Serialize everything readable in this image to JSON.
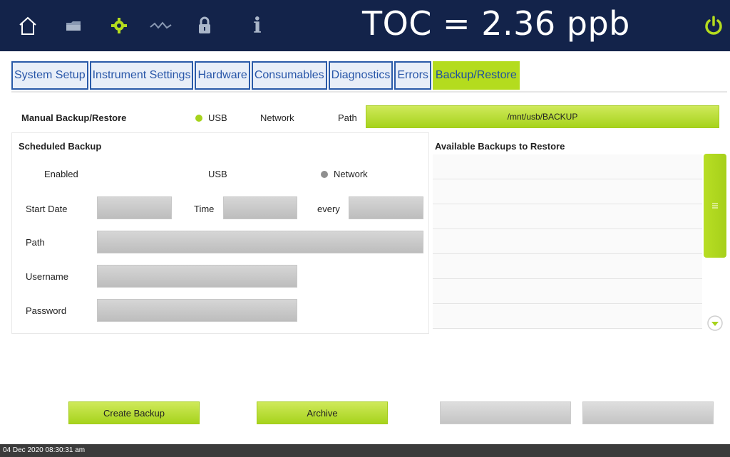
{
  "header": {
    "toc_reading": "TOC = 2.36 ppb",
    "icons": [
      "home-icon",
      "folder-icon",
      "gear-icon",
      "wave-icon",
      "lock-icon",
      "info-icon",
      "power-icon"
    ]
  },
  "tabs": [
    {
      "label": "System Setup",
      "active": false
    },
    {
      "label": "Instrument Settings",
      "active": false
    },
    {
      "label": "Hardware",
      "active": false
    },
    {
      "label": "Consumables",
      "active": false
    },
    {
      "label": "Diagnostics",
      "active": false
    },
    {
      "label": "Errors",
      "active": false
    },
    {
      "label": "Backup/Restore",
      "active": true
    }
  ],
  "manual": {
    "title": "Manual Backup/Restore",
    "usb_label": "USB",
    "network_label": "Network",
    "path_label": "Path",
    "path_value": "/mnt/usb/BACKUP",
    "selected": "USB"
  },
  "scheduled": {
    "title": "Scheduled Backup",
    "enabled_label": "Enabled",
    "usb_label": "USB",
    "network_label": "Network",
    "start_date_label": "Start Date",
    "time_label": "Time",
    "every_label": "every",
    "path_label": "Path",
    "username_label": "Username",
    "password_label": "Password"
  },
  "available": {
    "title": "Available Backups to Restore"
  },
  "actions": {
    "create_backup": "Create Backup",
    "archive": "Archive"
  },
  "colors": {
    "accent": "#b4dc1e",
    "header_bg": "#13234a",
    "tab_text": "#2856a8"
  },
  "status": {
    "datetime": "04 Dec 2020 08:30:31 am"
  }
}
